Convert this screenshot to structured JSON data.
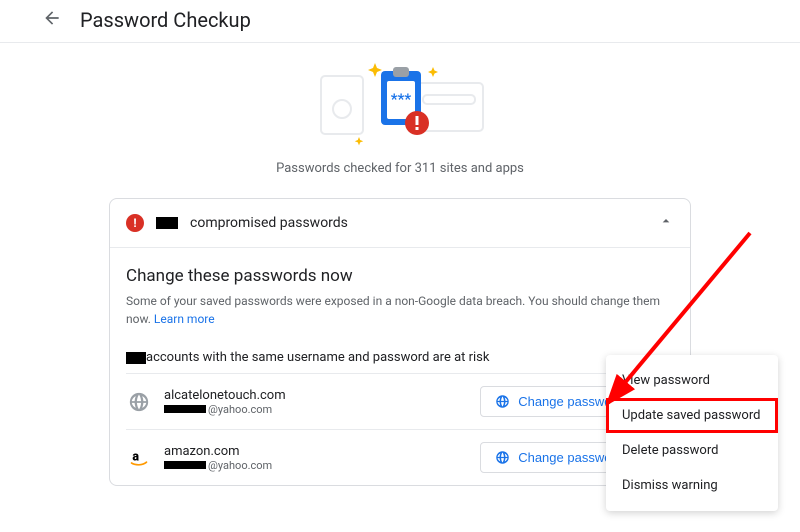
{
  "header": {
    "title": "Password Checkup"
  },
  "hero": {
    "caption": "Passwords checked for 311 sites and apps"
  },
  "card": {
    "title_suffix": " compromised passwords",
    "subhead": "Change these passwords now",
    "desc": "Some of your saved passwords were exposed in a non-Google data breach. You should change them now. ",
    "learn_more": "Learn more",
    "risk_line_suffix": "accounts with the same username and password are at risk"
  },
  "accounts": [
    {
      "site": "alcatelonetouch.com",
      "email_suffix": "@yahoo.com",
      "change": "Change password"
    },
    {
      "site": "amazon.com",
      "email_suffix": "@yahoo.com",
      "change": "Change password"
    }
  ],
  "menu": {
    "view": "View password",
    "update": "Update saved password",
    "delete": "Delete password",
    "dismiss": "Dismiss warning"
  }
}
